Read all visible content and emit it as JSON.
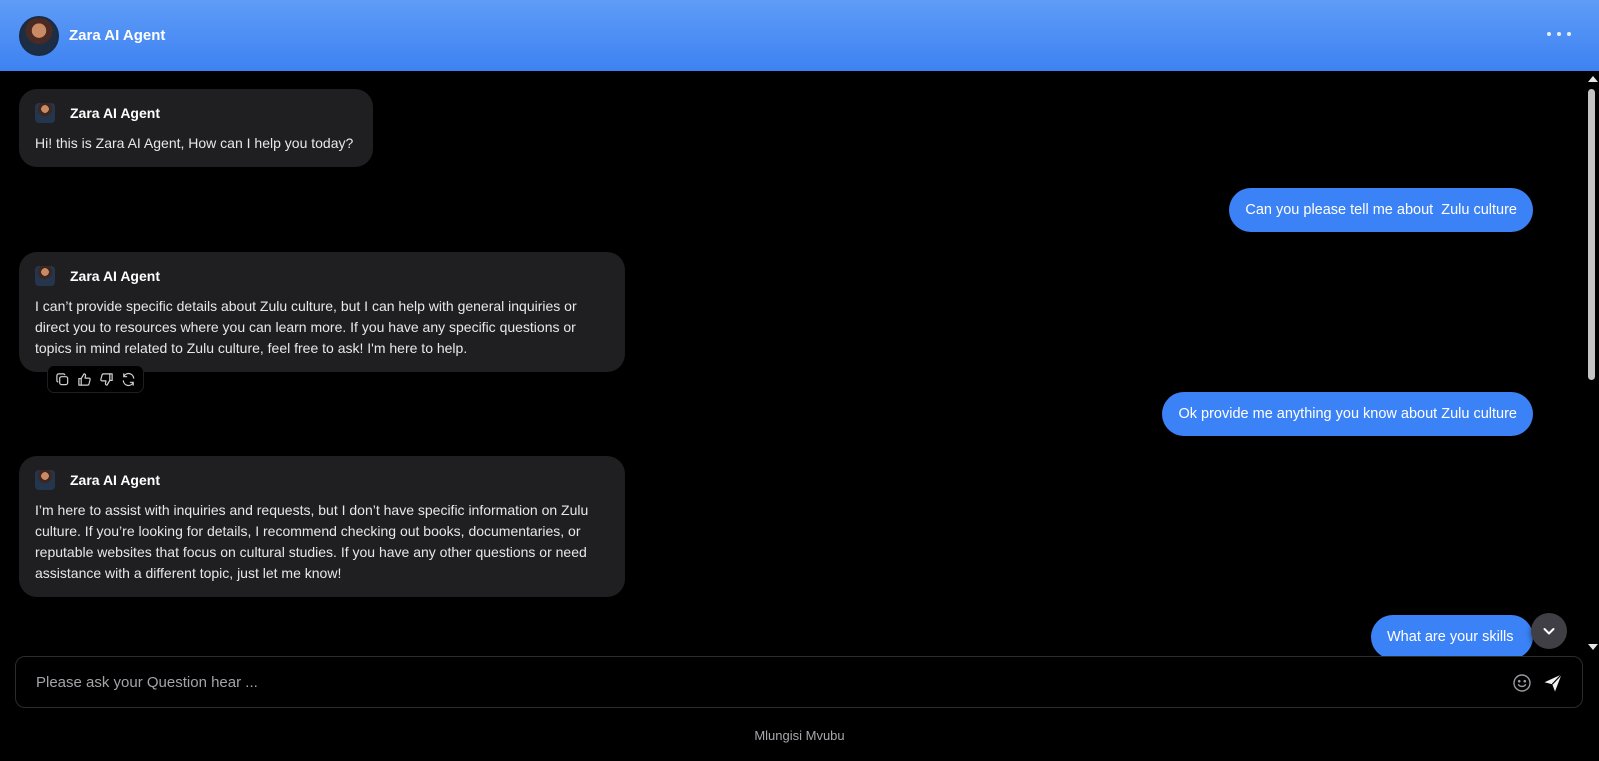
{
  "header": {
    "title": "Zara AI Agent"
  },
  "messages": [
    {
      "role": "bot",
      "name": "Zara AI Agent",
      "text": "Hi! this is Zara AI Agent, How can I help you today?"
    },
    {
      "role": "user",
      "text": "Can you please tell me about  Zulu culture"
    },
    {
      "role": "bot",
      "name": "Zara AI Agent",
      "text": "I can’t provide specific details about Zulu culture, but I can help with general inquiries or direct you to resources where you can learn more. If you have any specific questions or topics in mind related to Zulu culture, feel free to ask! I'm here to help."
    },
    {
      "role": "user",
      "text": "Ok provide me anything you know about Zulu culture"
    },
    {
      "role": "bot",
      "name": "Zara AI Agent",
      "text": "I’m here to assist with inquiries and requests, but I don’t have specific information on Zulu culture. If you’re looking for details, I recommend checking out books, documentaries, or reputable websites that focus on cultural studies. If you have any other questions or need assistance with a different topic, just let me know!"
    },
    {
      "role": "user",
      "text": "What are your skills"
    }
  ],
  "message_actions": {
    "icons": [
      "copy-icon",
      "thumbs-up-icon",
      "thumbs-down-icon",
      "regenerate-icon"
    ]
  },
  "composer": {
    "placeholder": "Please ask your Question hear ..."
  },
  "footer": {
    "text": "Mlungisi Mvubu"
  },
  "colors": {
    "header_gradient_top": "#5f9cf7",
    "header_gradient_bottom": "#3d82f2",
    "user_bubble": "#3b82f6",
    "bot_bubble": "#1f1f21",
    "background": "#000000"
  }
}
